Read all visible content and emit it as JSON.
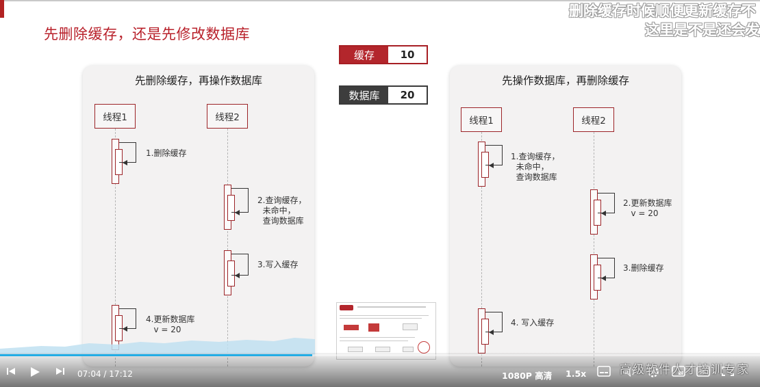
{
  "slide": {
    "title": "先删除缓存，还是先修改数据库"
  },
  "danmaku": [
    "删除缓存时候顺便更新缓存不",
    "这里是不是还会发"
  ],
  "state": {
    "cache": {
      "label": "缓存",
      "value": "10"
    },
    "db": {
      "label": "数据库",
      "value": "20"
    }
  },
  "panels": {
    "left": {
      "title": "先删除缓存，再操作数据库",
      "thread1": "线程1",
      "thread2": "线程2",
      "steps": [
        "1.删除缓存",
        "2.查询缓存，\n  未命中，\n  查询数据库",
        "3.写入缓存",
        "4.更新数据库\n   v = 20"
      ]
    },
    "right": {
      "title": "先操作数据库，再删除缓存",
      "thread1": "线程1",
      "thread2": "线程2",
      "steps": [
        "1.查询缓存，\n  未命中，\n  查询数据库",
        "2.更新数据库\n   v = 20",
        "3.删除缓存",
        "4. 写入缓存"
      ]
    }
  },
  "player": {
    "current_time": "07:04",
    "separator": "/",
    "duration": "17:12",
    "quality": "1080P 高清",
    "speed": "1.5x",
    "progress_fraction": 0.411,
    "watermark": "高级软件人才培训专家",
    "accent_color": "#23ade5"
  },
  "icons": {
    "prev": "skip-back-icon",
    "play": "play-icon",
    "next": "skip-forward-icon",
    "subtitle": "subtitle-icon",
    "volume": "volume-icon",
    "settings": "gear-icon",
    "pip": "picture-in-picture-icon",
    "widescreen": "widescreen-icon",
    "fullscreen": "fullscreen-icon"
  }
}
